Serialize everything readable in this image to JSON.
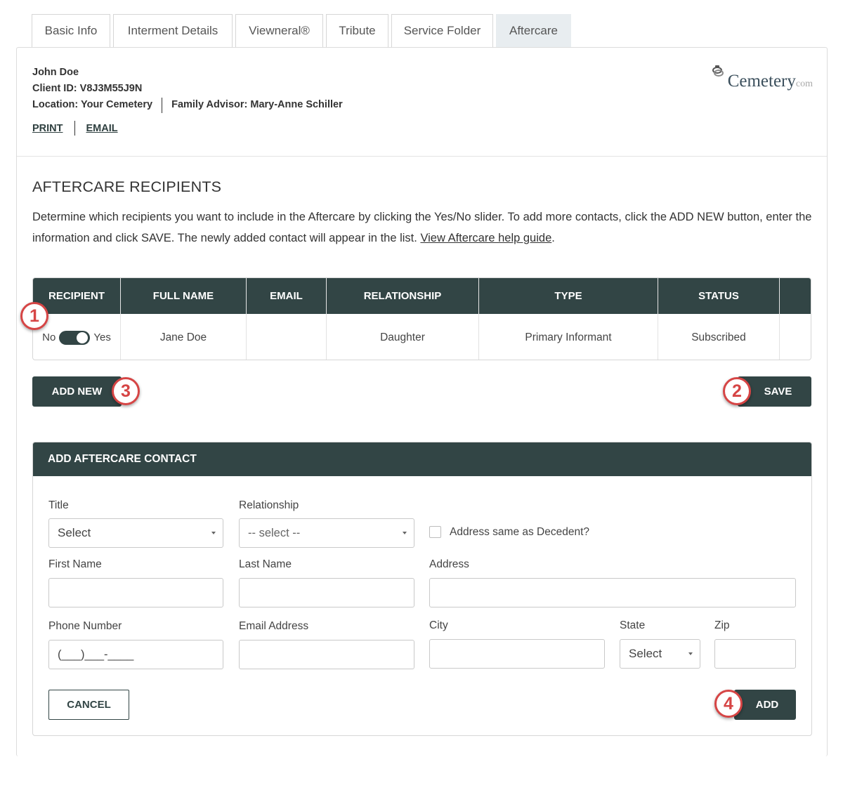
{
  "tabs": [
    {
      "label": "Basic Info"
    },
    {
      "label": "Interment Details"
    },
    {
      "label": "Viewneral®"
    },
    {
      "label": "Tribute"
    },
    {
      "label": "Service Folder"
    },
    {
      "label": "Aftercare",
      "active": true
    }
  ],
  "client": {
    "name": "John Doe",
    "client_id": "Client ID: V8J3M55J9N",
    "location": "Location: Your Cemetery",
    "advisor": "Family Advisor: Mary-Anne Schiller"
  },
  "links": {
    "print": "PRINT",
    "email": "EMAIL"
  },
  "logo": {
    "word": "Cemetery",
    "suffix": "com"
  },
  "section": {
    "title": "AFTERCARE RECIPIENTS",
    "description": "Determine which recipients you want to include in the Aftercare by clicking the Yes/No slider. To add more contacts, click the ADD NEW button, enter the information and click SAVE. The newly added contact will appear in the list.",
    "help_link": "View Aftercare help guide",
    "help_suffix": "."
  },
  "table": {
    "headers": [
      "RECIPIENT",
      "FULL NAME",
      "EMAIL",
      "RELATIONSHIP",
      "TYPE",
      "STATUS",
      ""
    ],
    "rows": [
      {
        "toggle_no": "No",
        "toggle_yes": "Yes",
        "toggle_state": "Yes",
        "full_name": "Jane Doe",
        "email": "",
        "relationship": "Daughter",
        "type": "Primary Informant",
        "status": "Subscribed"
      }
    ]
  },
  "buttons": {
    "add_new": "ADD NEW",
    "save": "SAVE",
    "cancel": "CANCEL",
    "add": "ADD"
  },
  "callouts": [
    "1",
    "2",
    "3",
    "4"
  ],
  "form": {
    "title": "ADD AFTERCARE CONTACT",
    "title_label": "Title",
    "title_value": "Select",
    "relationship_label": "Relationship",
    "relationship_value": "-- select --",
    "address_same_label": "Address same as Decedent?",
    "first_name_label": "First Name",
    "last_name_label": "Last Name",
    "address_label": "Address",
    "phone_label": "Phone Number",
    "phone_value": "(___)___-____",
    "email_label": "Email Address",
    "city_label": "City",
    "state_label": "State",
    "state_value": "Select",
    "zip_label": "Zip"
  },
  "colors": {
    "primary_dark": "#324545",
    "callout_red": "#d64545",
    "active_tab": "#e8edf0"
  }
}
